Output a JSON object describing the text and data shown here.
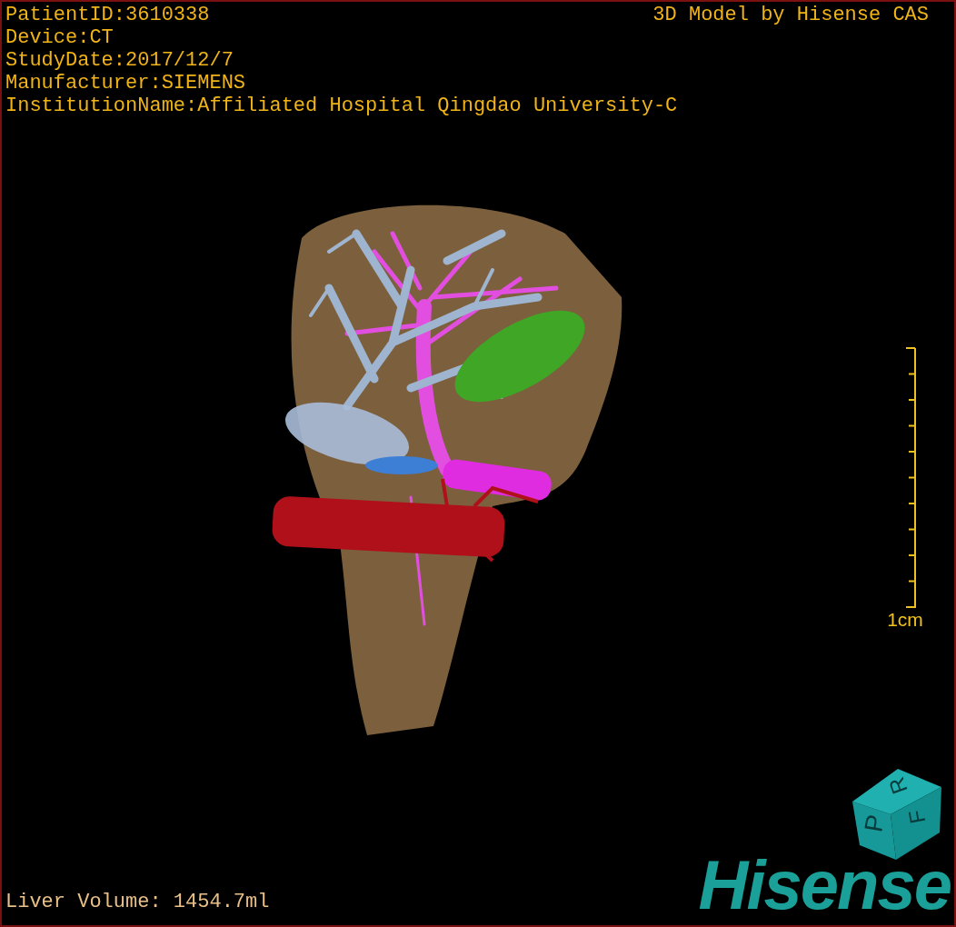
{
  "info_lines": [
    "PatientID:3610338",
    "Device:CT",
    "StudyDate:2017/12/7",
    "Manufacturer:SIEMENS",
    "InstitutionName:Affiliated Hospital Qingdao University-C"
  ],
  "title": "3D Model by Hisense CAS",
  "scale_bar": {
    "label": "1cm"
  },
  "orientation_cube": {
    "faces": [
      "P",
      "R",
      "F"
    ]
  },
  "liver_volume": "Liver Volume: 1454.7ml",
  "logo": "Hisense"
}
